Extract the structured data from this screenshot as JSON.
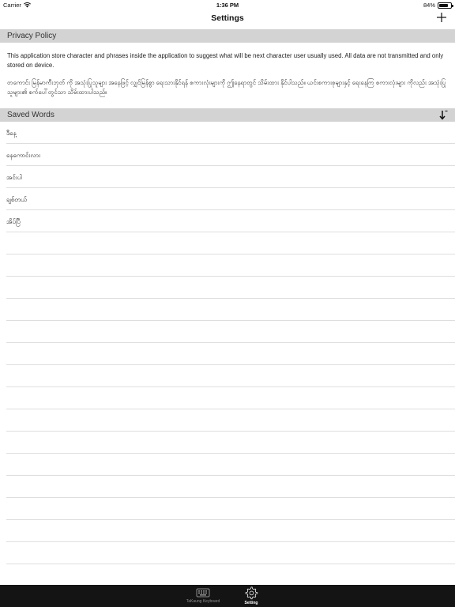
{
  "status_bar": {
    "carrier": "Carrier",
    "time": "1:36 PM",
    "battery": "84%",
    "wifi_icon": "wifi-icon",
    "battery_icon": "battery-icon"
  },
  "nav": {
    "title": "Settings",
    "add_icon": "plus-icon"
  },
  "privacy": {
    "header": "Privacy Policy",
    "english_text": "This application store character and phrases inside the application to suggest what will be next character user usually used. All data are not transmitted and only stored on device.",
    "myanmar_text": "တကောင်း မြန်မာကီးဘုတ် ကို အသုံးပြုသူများ အနေဖြင့် လျှင်မြန်စွာ ရေးသားနိုင်ရန် စကားလုံးများကို ဤနေရာတွင် သိမ်းထား နိုင်ပါသည်။ ယင်းစကားစုများနှင့် ရေးနေကြ စကားလုံးများ ကိုလည်း အသုံးပြု သူများ၏ စက်ပေါ်တွင်သာ သိမ်းထားပါသည်။"
  },
  "saved_words": {
    "header": "Saved Words",
    "sort_icon": "sort-down-icon",
    "items": [
      {
        "label": "ဒီနေ့"
      },
      {
        "label": "နေကောင်းလား"
      },
      {
        "label": "အင်းပါ"
      },
      {
        "label": "ချစ်တယ်"
      },
      {
        "label": "အိပ်ပြီ"
      }
    ],
    "empty_rows": 15
  },
  "tab_bar": {
    "tabs": [
      {
        "label": "TaKaung Keyboard",
        "icon": "keyboard-icon",
        "selected": false
      },
      {
        "label": "Setting",
        "icon": "gear-icon",
        "selected": true
      }
    ]
  },
  "colors": {
    "section_header_bg": "#d3d3d3",
    "tab_bar_bg": "#141414",
    "tab_selected": "#ffffff",
    "tab_unselected": "#8e8e8e"
  }
}
